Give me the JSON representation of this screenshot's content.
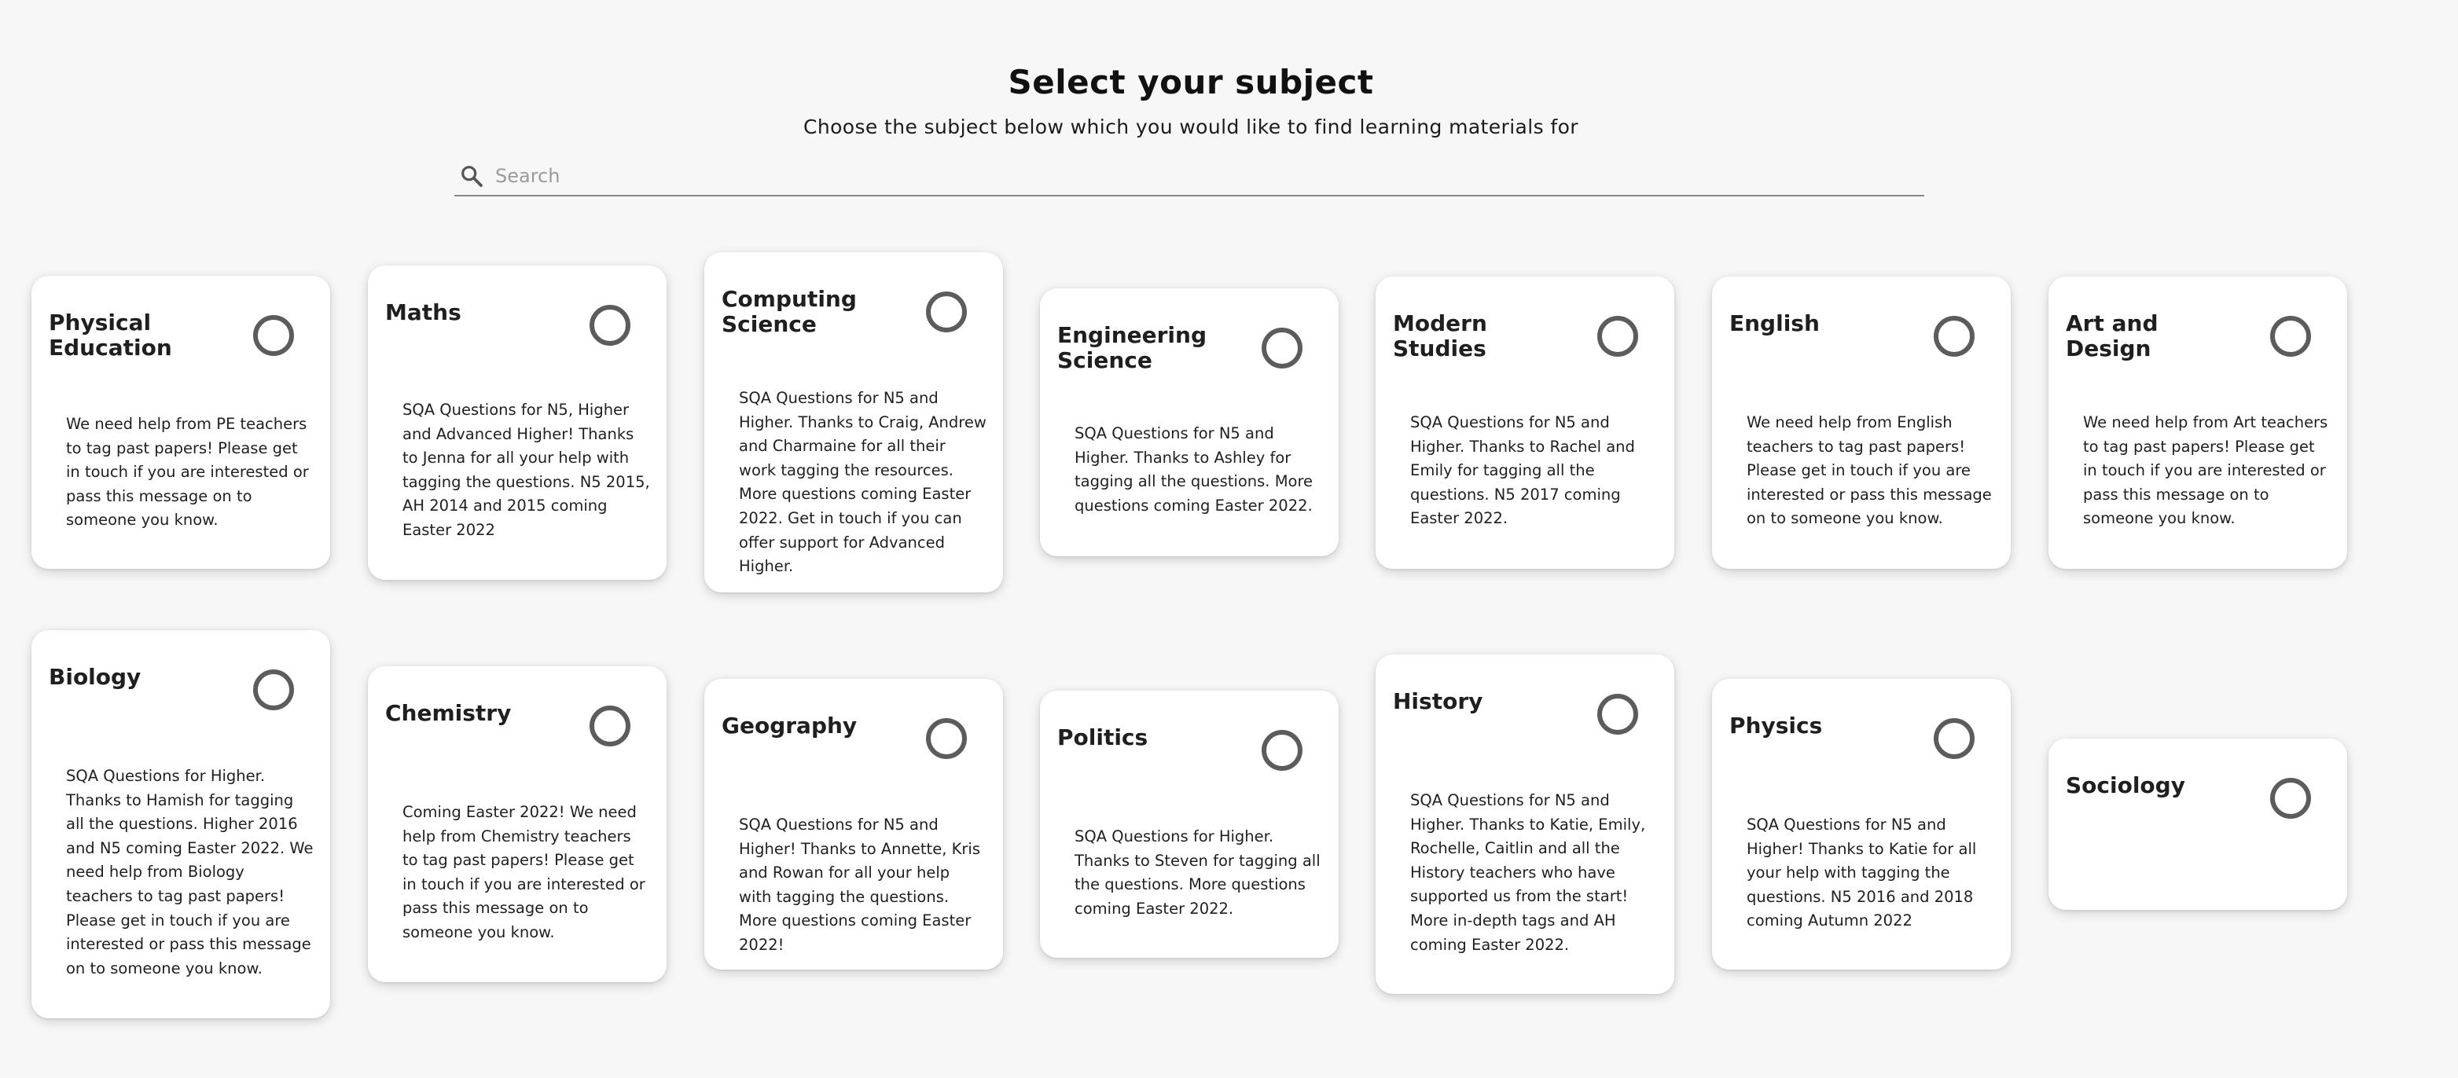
{
  "header": {
    "title": "Select your subject",
    "subtitle": "Choose the subject below which you would like to find learning materials for"
  },
  "search": {
    "placeholder": "Search",
    "value": ""
  },
  "subjects": [
    {
      "name": "Physical Education",
      "selected": false,
      "description": "We need help from PE teachers to tag past papers! Please get in touch if you are interested or pass this message on to someone you know."
    },
    {
      "name": "Maths",
      "selected": false,
      "description": "SQA Questions for N5, Higher and Advanced Higher! Thanks to Jenna for all your help with tagging the questions. N5 2015, AH 2014 and 2015 coming Easter 2022"
    },
    {
      "name": "Computing Science",
      "selected": false,
      "description": "SQA Questions for N5 and Higher. Thanks to Craig, Andrew and Charmaine for all their work tagging the resources. More questions coming Easter 2022. Get in touch if you can offer support for Advanced Higher."
    },
    {
      "name": "Engineering Science",
      "selected": false,
      "description": "SQA Questions for N5 and Higher. Thanks to Ashley for tagging all the questions. More questions coming Easter 2022."
    },
    {
      "name": "Modern Studies",
      "selected": false,
      "description": "SQA Questions for N5 and Higher. Thanks to Rachel and Emily for tagging all the questions. N5 2017 coming Easter 2022."
    },
    {
      "name": "English",
      "selected": false,
      "description": "We need help from English teachers to tag past papers! Please get in touch if you are interested or pass this message on to someone you know."
    },
    {
      "name": "Art and Design",
      "selected": false,
      "description": "We need help from Art teachers to tag past papers! Please get in touch if you are interested or pass this message on to someone you know."
    },
    {
      "name": "Biology",
      "selected": false,
      "description": "SQA Questions for Higher. Thanks to Hamish for tagging all the questions. Higher 2016 and N5 coming Easter 2022. We need help from Biology teachers to tag past papers! Please get in touch if you are interested or pass this message on to someone you know."
    },
    {
      "name": "Chemistry",
      "selected": false,
      "description": "Coming Easter 2022! We need help from Chemistry teachers to tag past papers! Please get in touch if you are interested or pass this message on to someone you know."
    },
    {
      "name": "Geography",
      "selected": false,
      "description": "SQA Questions for N5 and Higher! Thanks to Annette, Kris and Rowan for all your help with tagging the questions. More questions coming Easter 2022!"
    },
    {
      "name": "Politics",
      "selected": false,
      "description": "SQA Questions for Higher. Thanks to Steven for tagging all the questions. More questions coming Easter 2022."
    },
    {
      "name": "History",
      "selected": false,
      "description": "SQA Questions for N5 and Higher. Thanks to Katie, Emily, Rochelle, Caitlin and all the History teachers who have supported us from the start! More in-depth tags and AH coming Easter 2022."
    },
    {
      "name": "Physics",
      "selected": false,
      "description": "SQA Questions for N5 and Higher! Thanks to Katie for all your help with tagging the questions. N5 2016 and 2018 coming Autumn 2022"
    },
    {
      "name": "Sociology",
      "selected": false,
      "description": ""
    }
  ],
  "icons": {
    "search": "search-icon",
    "select": "radio-unchecked-icon"
  },
  "colors": {
    "background": "#f7f7f7",
    "card": "#ffffff",
    "radio_border": "#5c5c5c"
  }
}
